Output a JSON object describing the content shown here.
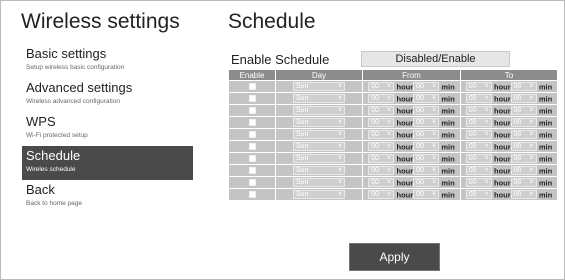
{
  "sidebar": {
    "title": "Wireless settings",
    "items": [
      {
        "label": "Basic settings",
        "sub": "Setup wireless basic configuration",
        "active": false
      },
      {
        "label": "Advanced settings",
        "sub": "Wireless advanced configuration",
        "active": false
      },
      {
        "label": "WPS",
        "sub": "Wi-Fi protected setup",
        "active": false
      },
      {
        "label": "Schedule",
        "sub": "Wireles schedule",
        "active": true
      },
      {
        "label": "Back",
        "sub": "Back to home page",
        "active": false
      }
    ]
  },
  "main": {
    "title": "Schedule",
    "enable_label": "Enable Schedule",
    "toggle_label": "Disabled/Enable",
    "columns": [
      "Enable",
      "Day",
      "From",
      "To"
    ],
    "unit_hour": "hour",
    "unit_min": "min",
    "rows": [
      {
        "enabled": false,
        "day": "Sun",
        "from_hour": "00",
        "from_min": "00",
        "to_hour": "00",
        "to_min": "00"
      },
      {
        "enabled": false,
        "day": "Sun",
        "from_hour": "00",
        "from_min": "00",
        "to_hour": "00",
        "to_min": "00"
      },
      {
        "enabled": false,
        "day": "Sun",
        "from_hour": "00",
        "from_min": "00",
        "to_hour": "00",
        "to_min": "00"
      },
      {
        "enabled": false,
        "day": "Sun",
        "from_hour": "00",
        "from_min": "00",
        "to_hour": "00",
        "to_min": "00"
      },
      {
        "enabled": false,
        "day": "Sun",
        "from_hour": "00",
        "from_min": "00",
        "to_hour": "00",
        "to_min": "00"
      },
      {
        "enabled": false,
        "day": "Sun",
        "from_hour": "00",
        "from_min": "00",
        "to_hour": "00",
        "to_min": "00"
      },
      {
        "enabled": false,
        "day": "Sun",
        "from_hour": "00",
        "from_min": "00",
        "to_hour": "00",
        "to_min": "00"
      },
      {
        "enabled": false,
        "day": "Sun",
        "from_hour": "00",
        "from_min": "00",
        "to_hour": "00",
        "to_min": "00"
      },
      {
        "enabled": false,
        "day": "Sun",
        "from_hour": "00",
        "from_min": "00",
        "to_hour": "00",
        "to_min": "00"
      },
      {
        "enabled": false,
        "day": "Sun",
        "from_hour": "00",
        "from_min": "00",
        "to_hour": "00",
        "to_min": "00"
      }
    ],
    "apply_label": "Apply"
  },
  "colors": {
    "active_nav_bg": "#4a4a4a",
    "table_header_bg": "#8c8c8c",
    "table_cell_bg": "#c4c4c4",
    "apply_bg": "#4a4a4a"
  },
  "icons": {
    "dropdown": "chevron-down-icon"
  }
}
